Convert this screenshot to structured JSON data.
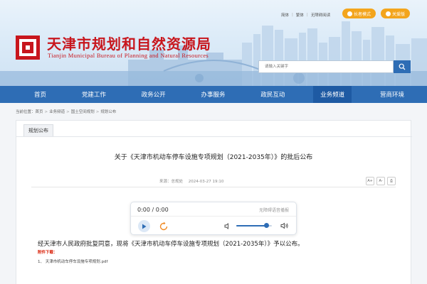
{
  "header": {
    "title_cn": "天津市规划和自然资源局",
    "title_en": "Tianjin Municipal Bureau of Planning and Natural Resources",
    "toplinks": [
      "简体",
      "繁体",
      "无障碍阅读"
    ],
    "pill_senior": "长者模式",
    "pill_care": "关爱版",
    "search_placeholder": "请输入关键字",
    "colors": {
      "brand_red": "#c8161d",
      "nav_blue": "#2e6db5",
      "accent_orange": "#f3a51d"
    }
  },
  "nav": {
    "items": [
      "首页",
      "党建工作",
      "政务公开",
      "办事服务",
      "政民互动",
      "业务频道",
      "营商环境"
    ],
    "active": "业务频道"
  },
  "breadcrumb": {
    "label": "当前位置：",
    "items": [
      "首页",
      "业务频道",
      "国土空间规划",
      "规划公布"
    ]
  },
  "tab": {
    "label": "规划公布"
  },
  "article": {
    "title": "关于《天津市机动车停车设施专项规划（2021-2035年）》的批后公布",
    "source": "来源：总规处",
    "date": "2024-03-27 19:10",
    "font_buttons": [
      "A+",
      "A-",
      "⎙"
    ],
    "body": "经天津市人民政府批复同意，现将《天津市机动车停车设施专项规划（2021-2035年）》予以公布。",
    "attachment_label": "附件下载：",
    "attachments": [
      "1、 天津市机动车停车设施专项规划.pdf"
    ]
  },
  "player": {
    "time": "0:00 / 0:00",
    "hint": "无障碍语音播报",
    "volume": 0.85,
    "icons": {
      "play": "play-icon",
      "replay": "replay-icon",
      "volume_low": "volume-low-icon",
      "volume_high": "volume-high-icon"
    }
  }
}
